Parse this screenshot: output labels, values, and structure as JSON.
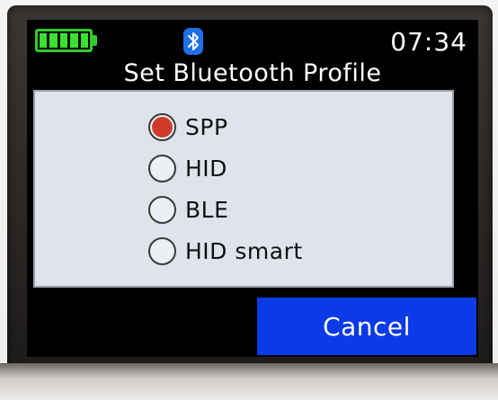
{
  "status_bar": {
    "battery_icon": "battery-full-icon",
    "bluetooth_icon": "bluetooth-icon",
    "time": "07:34"
  },
  "title": "Set Bluetooth Profile",
  "options": [
    {
      "label": "SPP",
      "selected": true
    },
    {
      "label": "HID",
      "selected": false
    },
    {
      "label": "BLE",
      "selected": false
    },
    {
      "label": "HID smart",
      "selected": false
    }
  ],
  "cancel_label": "Cancel",
  "colors": {
    "screen_background": "#000000",
    "panel_background": "#dfe3ec",
    "selected_radio": "#cf3b2a",
    "cancel_button": "#0b3be6",
    "battery": "#3be132",
    "bluetooth_badge": "#1f6fe6"
  }
}
